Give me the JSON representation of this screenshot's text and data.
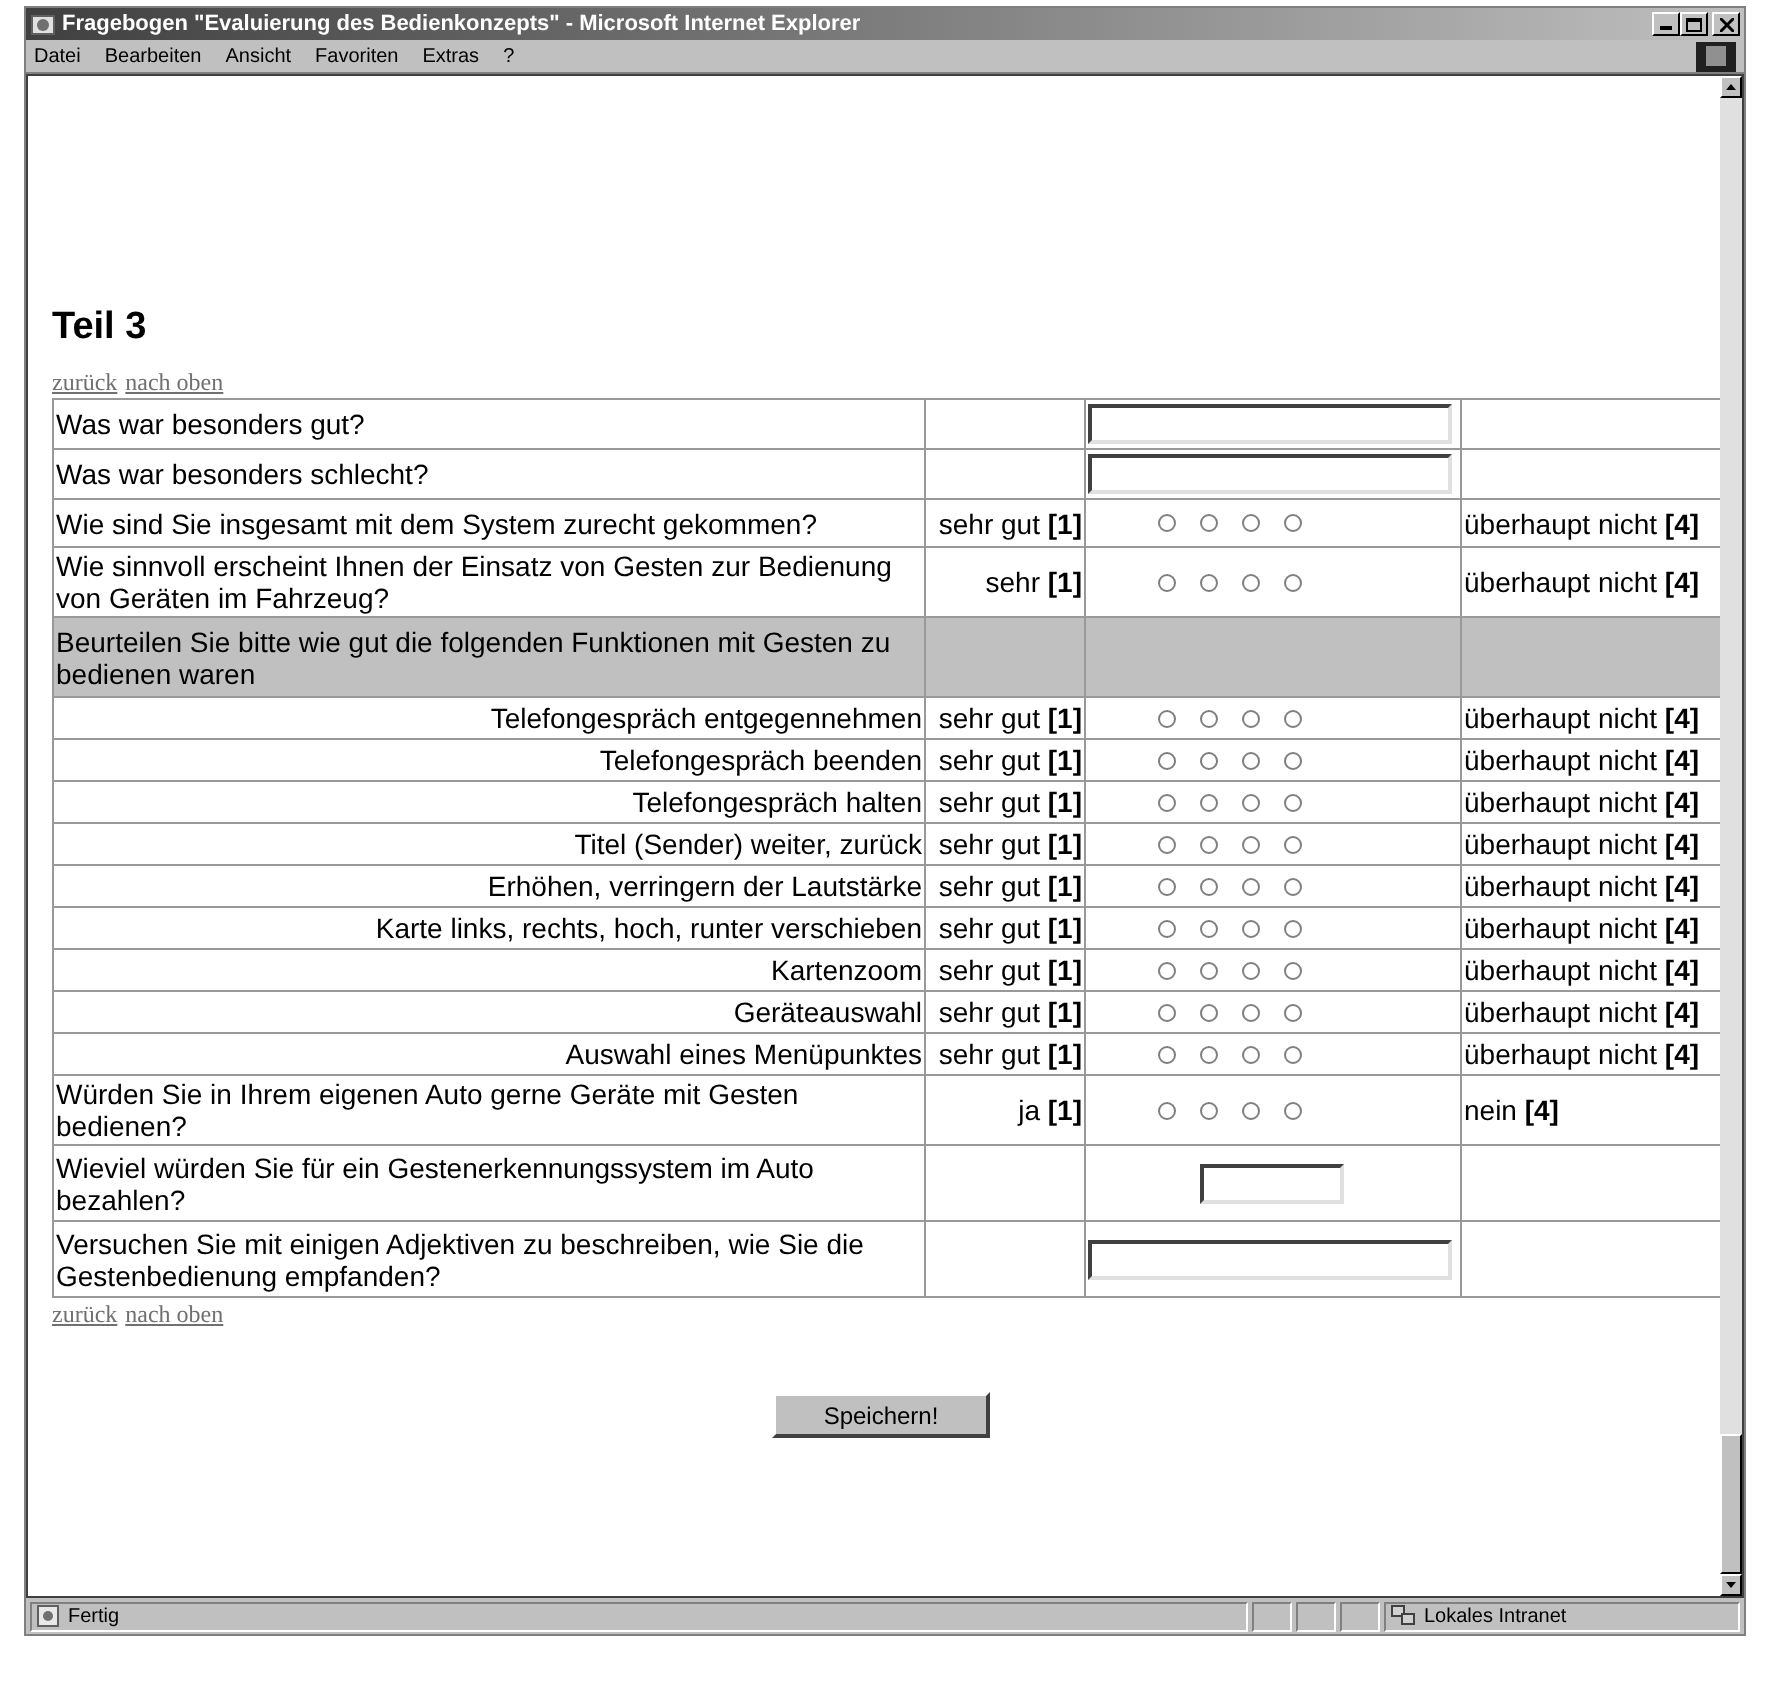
{
  "window": {
    "title": "Fragebogen \"Evaluierung des Bedienkonzepts\" - Microsoft Internet Explorer"
  },
  "menu": [
    "Datei",
    "Bearbeiten",
    "Ansicht",
    "Favoriten",
    "Extras",
    "?"
  ],
  "heading": "Teil 3",
  "nav_top": [
    "zurück",
    "nach oben"
  ],
  "rows": [
    {
      "kind": "text_field",
      "question": "Was war besonders gut?"
    },
    {
      "kind": "text_field",
      "question": "Was war besonders schlecht?"
    },
    {
      "kind": "scale",
      "question": "Wie sind Sie insgesamt mit dem System zurecht gekommen?",
      "left": "sehr gut **[1]**",
      "right": "überhaupt nicht **[4]**",
      "options": [
        {
          "selected": false
        },
        {
          "selected": false
        },
        {
          "selected": false
        },
        {
          "selected": false
        }
      ]
    },
    {
      "kind": "scale",
      "question": "Wie sinnvoll erscheint Ihnen der Einsatz von Gesten zur Bedienung von Geräten im Fahrzeug?",
      "left": "sehr **[1]**",
      "right": "überhaupt nicht **[4]**",
      "options": [
        {
          "selected": false
        },
        {
          "selected": false
        },
        {
          "selected": false
        },
        {
          "selected": false
        }
      ]
    },
    {
      "kind": "section",
      "question": "Beurteilen Sie bitte wie gut die folgenden Funktionen mit Gesten zu bedienen waren"
    },
    {
      "kind": "sub_scale",
      "question": "Telefongespräch entgegennehmen",
      "left": "sehr gut **[1]**",
      "right": "überhaupt nicht **[4]**",
      "options": [
        {
          "selected": false
        },
        {
          "selected": false
        },
        {
          "selected": false
        },
        {
          "selected": false
        }
      ]
    },
    {
      "kind": "sub_scale",
      "question": "Telefongespräch beenden",
      "left": "sehr gut **[1]**",
      "right": "überhaupt nicht **[4]**",
      "options": [
        {
          "selected": false
        },
        {
          "selected": false
        },
        {
          "selected": false
        },
        {
          "selected": false
        }
      ]
    },
    {
      "kind": "sub_scale",
      "question": "Telefongespräch halten",
      "left": "sehr gut **[1]**",
      "right": "überhaupt nicht **[4]**",
      "options": [
        {
          "selected": false
        },
        {
          "selected": false
        },
        {
          "selected": false
        },
        {
          "selected": false
        }
      ]
    },
    {
      "kind": "sub_scale",
      "question": "Titel (Sender) weiter, zurück",
      "left": "sehr gut **[1]**",
      "right": "überhaupt nicht **[4]**",
      "options": [
        {
          "selected": false
        },
        {
          "selected": false
        },
        {
          "selected": false
        },
        {
          "selected": false
        }
      ]
    },
    {
      "kind": "sub_scale",
      "question": "Erhöhen, verringern der Lautstärke",
      "left": "sehr gut **[1]**",
      "right": "überhaupt nicht **[4]**",
      "options": [
        {
          "selected": false
        },
        {
          "selected": false
        },
        {
          "selected": false
        },
        {
          "selected": false
        }
      ]
    },
    {
      "kind": "sub_scale",
      "question": "Karte links, rechts, hoch, runter verschieben",
      "left": "sehr gut **[1]**",
      "right": "überhaupt nicht **[4]**",
      "options": [
        {
          "selected": false
        },
        {
          "selected": false
        },
        {
          "selected": false
        },
        {
          "selected": false
        }
      ]
    },
    {
      "kind": "sub_scale",
      "question": "Kartenzoom",
      "left": "sehr gut **[1]**",
      "right": "überhaupt nicht **[4]**",
      "options": [
        {
          "selected": false
        },
        {
          "selected": false
        },
        {
          "selected": false
        },
        {
          "selected": false
        }
      ]
    },
    {
      "kind": "sub_scale",
      "question": "Geräteauswahl",
      "left": "sehr gut **[1]**",
      "right": "überhaupt nicht **[4]**",
      "options": [
        {
          "selected": false
        },
        {
          "selected": false
        },
        {
          "selected": false
        },
        {
          "selected": false
        }
      ]
    },
    {
      "kind": "sub_scale",
      "question": "Auswahl eines Menüpunktes",
      "left": "sehr gut **[1]**",
      "right": "überhaupt nicht **[4]**",
      "options": [
        {
          "selected": false
        },
        {
          "selected": false
        },
        {
          "selected": false
        },
        {
          "selected": false
        }
      ]
    },
    {
      "kind": "scale",
      "question": "Würden Sie in Ihrem eigenen Auto gerne Geräte mit Gesten bedienen?",
      "left": "ja **[1]**",
      "right": "nein **[4]**",
      "options": [
        {
          "selected": false
        },
        {
          "selected": false
        },
        {
          "selected": false
        },
        {
          "selected": false
        }
      ]
    },
    {
      "kind": "small_field",
      "question": "Wieviel würden Sie für ein Gestenerkennungssystem im Auto bezahlen?"
    },
    {
      "kind": "wide_field",
      "question": "Versuchen Sie mit einigen Adjektiven zu beschreiben, wie Sie die Gestenbedienung empfanden?"
    }
  ],
  "nav_bottom": [
    "zurück",
    "nach oben"
  ],
  "submit": "Speichern!",
  "status_bar": {
    "text": "Fertig",
    "zone": "Lokales Intranet"
  }
}
